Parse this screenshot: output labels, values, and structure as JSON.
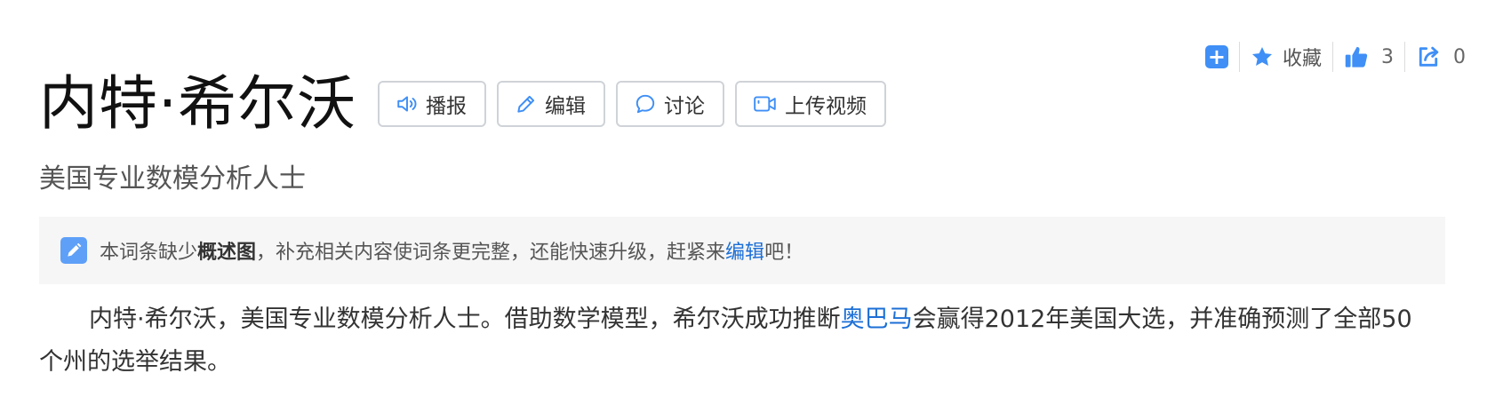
{
  "toolbar": {
    "add_icon": "plus-square-icon",
    "favorite_label": "收藏",
    "like_count": "3",
    "share_count": "0"
  },
  "header": {
    "title": "内特·希尔沃",
    "buttons": {
      "broadcast": "播报",
      "edit": "编辑",
      "discuss": "讨论",
      "upload_video": "上传视频"
    },
    "subtitle": "美国专业数模分析人士"
  },
  "notice": {
    "prefix": "本词条缺少",
    "bold": "概述图",
    "middle": "，补充相关内容使词条更完整，还能快速升级，赶紧来",
    "link": "编辑",
    "suffix": "吧！"
  },
  "summary": {
    "part1": "内特·希尔沃，美国专业数模分析人士。借助数学模型，希尔沃成功推断",
    "link": "奥巴马",
    "part2": "会赢得2012年美国大选，并准确预测了全部50个州的选举结果。"
  },
  "colors": {
    "accent": "#3f8ff6",
    "link": "#1c6fd6",
    "notice_bg": "#f6f6f6"
  }
}
